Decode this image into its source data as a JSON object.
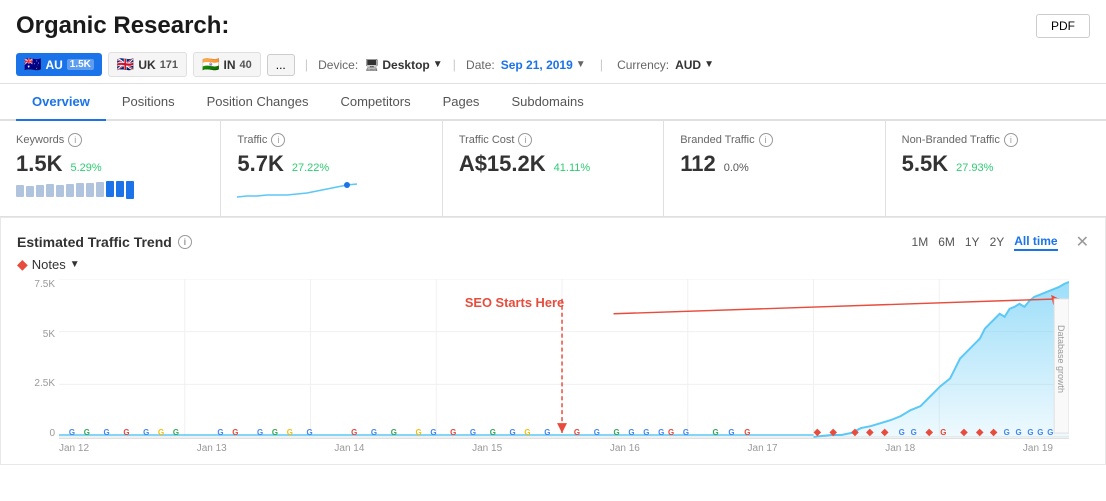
{
  "page": {
    "title": "Organic Research:",
    "pdf_btn": "PDF"
  },
  "country_tabs": [
    {
      "id": "au",
      "flag": "🇦🇺",
      "label": "AU",
      "count": "1.5K",
      "active": true
    },
    {
      "id": "uk",
      "flag": "🇬🇧",
      "label": "UK",
      "count": "171",
      "active": false
    },
    {
      "id": "in",
      "flag": "🇮🇳",
      "label": "IN",
      "count": "40",
      "active": false
    }
  ],
  "more_btn": "...",
  "device": {
    "label": "Device:",
    "value": "Desktop",
    "icon": "🖥"
  },
  "date": {
    "label": "Date:",
    "value": "Sep 21, 2019"
  },
  "currency": {
    "label": "Currency:",
    "value": "AUD"
  },
  "nav_tabs": [
    {
      "id": "overview",
      "label": "Overview",
      "active": true
    },
    {
      "id": "positions",
      "label": "Positions",
      "active": false
    },
    {
      "id": "position-changes",
      "label": "Position Changes",
      "active": false
    },
    {
      "id": "competitors",
      "label": "Competitors",
      "active": false
    },
    {
      "id": "pages",
      "label": "Pages",
      "active": false
    },
    {
      "id": "subdomains",
      "label": "Subdomains",
      "active": false
    }
  ],
  "metrics": [
    {
      "id": "keywords",
      "label": "Keywords",
      "value": "1.5K",
      "change": "5.29%",
      "has_sparkline": true
    },
    {
      "id": "traffic",
      "label": "Traffic",
      "value": "5.7K",
      "change": "27.22%",
      "has_sparkline": true
    },
    {
      "id": "traffic-cost",
      "label": "Traffic Cost",
      "value": "A$15.2K",
      "change": "41.11%",
      "has_sparkline": false
    },
    {
      "id": "branded-traffic",
      "label": "Branded Traffic",
      "value": "112",
      "change": "0.0%",
      "has_sparkline": false
    },
    {
      "id": "non-branded-traffic",
      "label": "Non-Branded Traffic",
      "value": "5.5K",
      "change": "27.93%",
      "has_sparkline": false
    }
  ],
  "chart": {
    "title": "Estimated Traffic Trend",
    "notes_label": "Notes",
    "seo_annotation": "SEO Starts Here",
    "db_label": "Database growth",
    "time_buttons": [
      "1M",
      "6M",
      "1Y",
      "2Y",
      "All time"
    ],
    "active_time": "All time",
    "y_labels": [
      "7.5K",
      "5K",
      "2.5K",
      "0"
    ],
    "x_labels": [
      "Jan 12",
      "Jan 13",
      "Jan 14",
      "Jan 15",
      "Jan 16",
      "Jan 17",
      "Jan 18",
      "Jan 19"
    ]
  },
  "info_icon": "i"
}
